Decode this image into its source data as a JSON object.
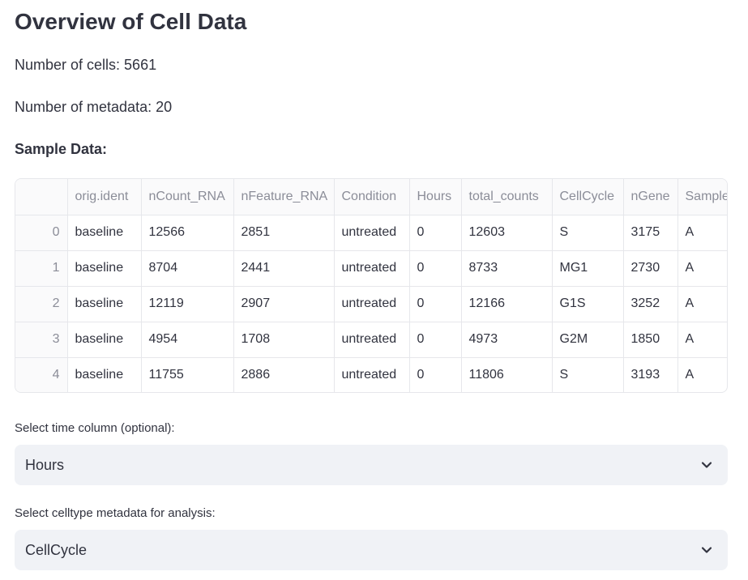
{
  "page": {
    "title": "Overview of Cell Data",
    "cells_line": "Number of cells: 5661",
    "metadata_line": "Number of metadata: 20",
    "sample_heading": "Sample Data:"
  },
  "table": {
    "columns": [
      "",
      "orig.ident",
      "nCount_RNA",
      "nFeature_RNA",
      "Condition",
      "Hours",
      "total_counts",
      "CellCycle",
      "nGene",
      "Sample"
    ],
    "rows": [
      [
        "0",
        "baseline",
        "12566",
        "2851",
        "untreated",
        "0",
        "12603",
        "S",
        "3175",
        "A"
      ],
      [
        "1",
        "baseline",
        "8704",
        "2441",
        "untreated",
        "0",
        "8733",
        "MG1",
        "2730",
        "A"
      ],
      [
        "2",
        "baseline",
        "12119",
        "2907",
        "untreated",
        "0",
        "12166",
        "G1S",
        "3252",
        "A"
      ],
      [
        "3",
        "baseline",
        "4954",
        "1708",
        "untreated",
        "0",
        "4973",
        "G2M",
        "1850",
        "A"
      ],
      [
        "4",
        "baseline",
        "11755",
        "2886",
        "untreated",
        "0",
        "11806",
        "S",
        "3193",
        "A"
      ]
    ]
  },
  "time_select": {
    "label": "Select time column (optional):",
    "value": "Hours",
    "icon": "chevron-down-icon"
  },
  "celltype_select": {
    "label": "Select celltype metadata for analysis:",
    "value": "CellCycle",
    "icon": "chevron-down-icon"
  }
}
